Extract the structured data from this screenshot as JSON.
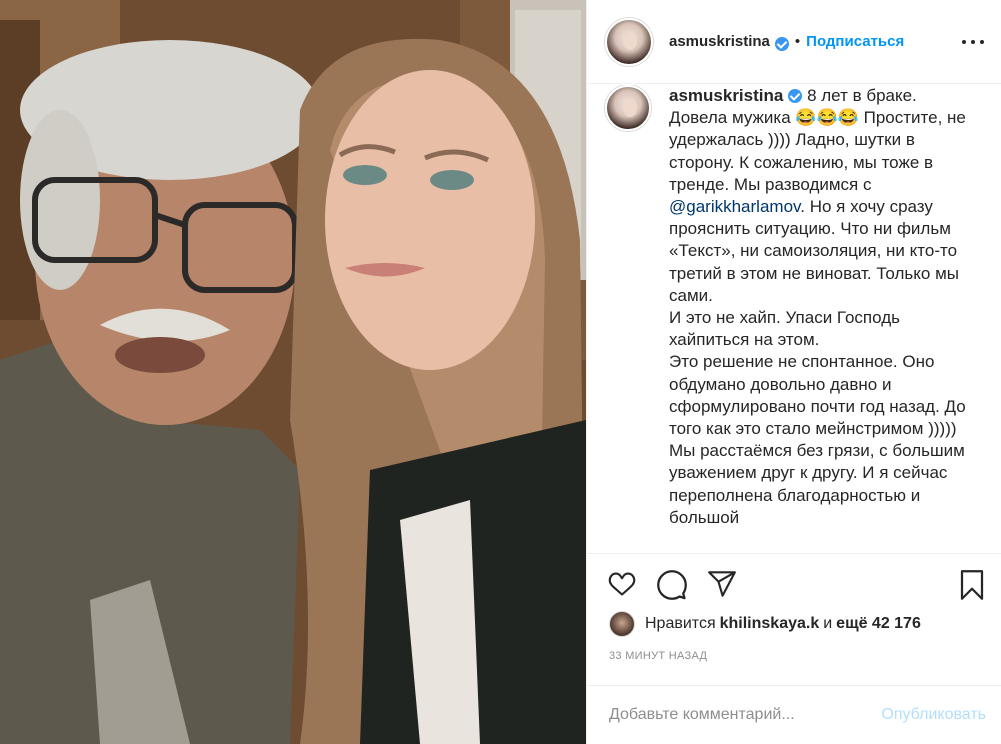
{
  "post": {
    "photo_icon": "selfie-photo",
    "accent": "#0095f6"
  },
  "header": {
    "username": "asmuskristina",
    "separator": "•",
    "follow_label": "Подписаться",
    "more_icon": "more-dots-icon"
  },
  "caption": {
    "username": "asmuskristina",
    "text_before_mention": "8 лет в браке.\nДовела мужика 😂😂😂 Простите, не удержалась )))) Ладно, шутки в сторону. К сожалению, мы тоже в тренде. Мы разводимся с ",
    "mention": "@garikkharlamov",
    "text_after_mention": ". Но я хочу сразу прояснить ситуацию. Что ни фильм «Текст», ни самоизоляция, ни кто-то третий в этом не виноват. Только мы сами.\nИ это не хайп. Упаси Господь хайпиться на этом.\nЭто решение не спонтанное. Оно обдумано довольно давно и сформулировано почти год назад. До того как это стало мейнстримом )))))\nМы расстаёмся без грязи, с большим уважением друг к другу. И я сейчас переполнена благодарностью и большой"
  },
  "actions": {
    "like_icon": "heart-icon",
    "comment_icon": "comment-icon",
    "share_icon": "share-icon",
    "save_icon": "bookmark-icon"
  },
  "likes": {
    "prefix": "Нравится",
    "liker": "khilinskaya.k",
    "conjunction": "и",
    "rest": "ещё 42 176"
  },
  "timestamp": "33 минут назад",
  "comment": {
    "placeholder": "Добавьте комментарий...",
    "value": "",
    "publish_label": "Опубликовать"
  }
}
